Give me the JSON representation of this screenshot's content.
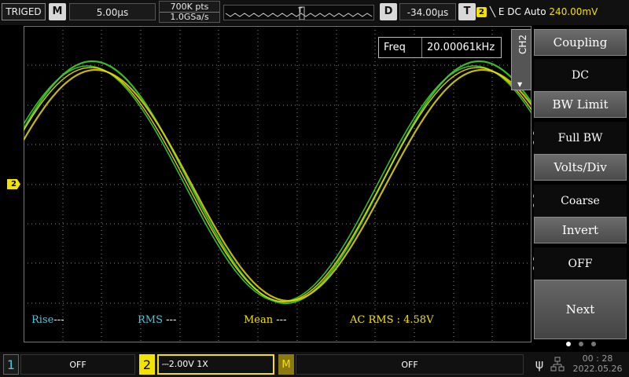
{
  "top_bar": {
    "trigger_status": "TRIGED",
    "timebase_key": "M",
    "timebase": "5.00μs",
    "memory_depth": "700K pts",
    "sample_rate": "1.0GSa/s",
    "delay_key": "D",
    "delay": "-34.00μs",
    "trigger_key": "T",
    "trigger_channel": "2",
    "trigger_settings": "E DC Auto",
    "trigger_level": "240.00mV"
  },
  "screen": {
    "frequency_label": "Freq",
    "frequency_value": "20.00061kHz",
    "channel_marker": "2",
    "measurements": {
      "rise_label": "Rise",
      "rise_value": "---",
      "rms_label": "RMS",
      "rms_value": "---",
      "mean_label": "Mean",
      "mean_value": "---",
      "acrms_label": "AC RMS :",
      "acrms_value": "4.58V"
    }
  },
  "side_menu": {
    "title": "CH2",
    "coupling_label": "Coupling",
    "coupling_value": "DC",
    "bwlimit_label": "BW Limit",
    "bwlimit_value": "Full BW",
    "voltsdiv_label": "Volts/Div",
    "voltsdiv_value": "Coarse",
    "invert_label": "Invert",
    "invert_value": "OFF",
    "next_label": "Next",
    "page_indicator": {
      "current": 1,
      "total": 3
    }
  },
  "bottom_bar": {
    "ch1_number": "1",
    "ch1_state": "OFF",
    "ch2_number": "2",
    "ch2_setting": "2.00V 1X",
    "math_key": "M",
    "math_state": "OFF",
    "time": "00 : 28",
    "date": "2022.05.26"
  },
  "colors": {
    "ch2_yellow": "#f2e200",
    "trace_green": "#3fcf2a",
    "measurement_cyan": "#4fc6d8"
  },
  "icons": [
    "usb-icon",
    "network-icon",
    "trigger-edge-icon"
  ]
}
